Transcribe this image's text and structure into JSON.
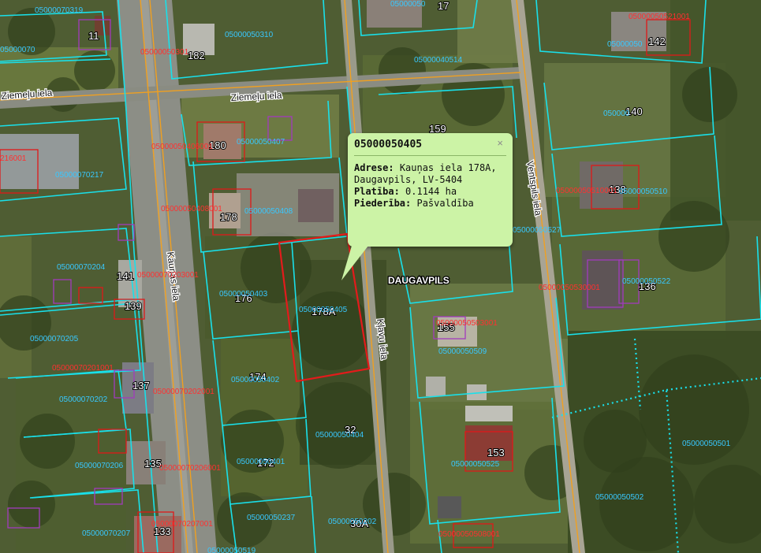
{
  "map": {
    "streets": [
      "Ziemeļu iela",
      "Ziemeļu iela",
      "Kauņas iela",
      "Kļavu iela",
      "Ventspils iela"
    ],
    "city_label": "DAUGAVPILS",
    "house_numbers": [
      "11",
      "182",
      "17",
      "142",
      "140",
      "180",
      "159",
      "178",
      "138",
      "141",
      "176",
      "178A",
      "139",
      "136",
      "155",
      "137",
      "174",
      "32",
      "135",
      "172",
      "153",
      "133",
      "30A"
    ],
    "parcel_ids_cyan": [
      "05000070319",
      "05000050310",
      "05000050",
      "05000040514",
      "05000050",
      "05000050407",
      "05000070217",
      "05000050408",
      "05000050510",
      "05000050527",
      "05000070204",
      "05000050403",
      "05000050405",
      "05000070205",
      "05000050509",
      "05000050522",
      "05000050402",
      "05000070202",
      "05000050404",
      "05000050401",
      "05000070206",
      "05000050525",
      "05000050501",
      "05000050502",
      "05000050237",
      "05000050202",
      "05000070207",
      "05000050519",
      "050000",
      "05000070"
    ],
    "parcel_ids_red": [
      "05000050301",
      "05000050521001",
      "05000050406001",
      "05000050408001",
      "05000050510001",
      "05000070203001",
      "05000070201001",
      "05000070202001",
      "05000050530001",
      "05000050503001",
      "05000070206001",
      "05000070207001",
      "05000050508001",
      "216001"
    ],
    "colors": {
      "parcel_line": "#19e0ea",
      "parcel_red": "#e01818",
      "parcel_purple": "#a23bbd",
      "road_orange": "#f0a020",
      "selection": "#e31b1b"
    }
  },
  "popup": {
    "title": "05000050405",
    "close": "×",
    "address_label": "Adrese:",
    "address_line1": "Kauņas iela 178A,",
    "address_line2": "Daugavpils, LV-5404",
    "area_label": "Platība:",
    "area_value": "0.1144 ha",
    "owner_label": "Piederība:",
    "owner_value": "Pašvaldība"
  }
}
